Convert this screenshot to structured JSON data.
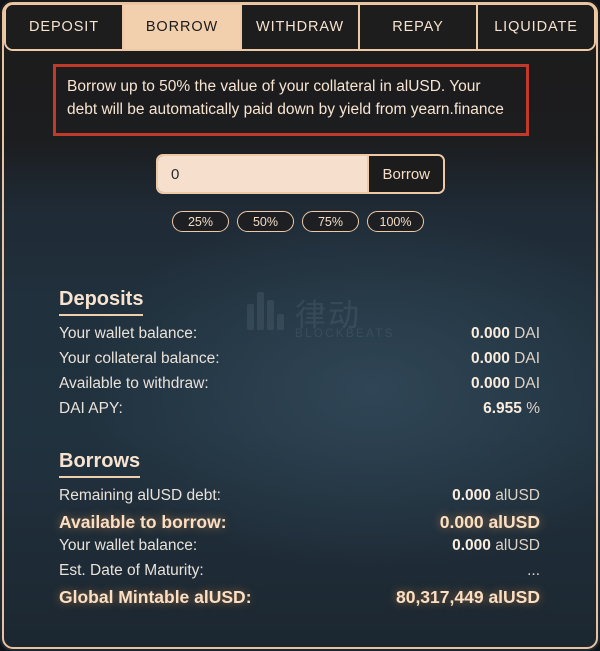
{
  "tabs": [
    {
      "label": "DEPOSIT",
      "active": false
    },
    {
      "label": "BORROW",
      "active": true
    },
    {
      "label": "WITHDRAW",
      "active": false
    },
    {
      "label": "REPAY",
      "active": false
    },
    {
      "label": "LIQUIDATE",
      "active": false
    }
  ],
  "notice": {
    "text": "Borrow up to 50% the value of your collateral in alUSD. Your debt will be automatically paid down by yield from yearn.finance",
    "border_color": "#c0392b"
  },
  "amount": {
    "value": "0",
    "placeholder": "0",
    "action_label": "Borrow"
  },
  "percent_buttons": [
    {
      "label": "25%"
    },
    {
      "label": "50%"
    },
    {
      "label": "75%"
    },
    {
      "label": "100%"
    }
  ],
  "watermark": {
    "cn": "律动",
    "en": "BLOCKBEATS"
  },
  "deposits": {
    "heading": "Deposits",
    "rows": [
      {
        "label": "Your wallet balance:",
        "number": "0.000",
        "unit": "DAI",
        "highlight": false
      },
      {
        "label": "Your collateral balance:",
        "number": "0.000",
        "unit": "DAI",
        "highlight": false
      },
      {
        "label": "Available to withdraw:",
        "number": "0.000",
        "unit": "DAI",
        "highlight": false
      },
      {
        "label": "DAI APY:",
        "number": "6.955",
        "unit": "%",
        "highlight": false
      }
    ]
  },
  "borrows": {
    "heading": "Borrows",
    "rows": [
      {
        "label": "Remaining alUSD debt:",
        "number": "0.000",
        "unit": "alUSD",
        "highlight": false
      },
      {
        "label": "Available to borrow:",
        "number": "0.000",
        "unit": "alUSD",
        "highlight": true
      },
      {
        "label": "Your wallet balance:",
        "number": "0.000",
        "unit": "alUSD",
        "highlight": false
      },
      {
        "label": "Est. Date of Maturity:",
        "number": "",
        "unit": "...",
        "highlight": false
      },
      {
        "label": "Global Mintable alUSD:",
        "number": "80,317,449",
        "unit": "alUSD",
        "highlight": true
      }
    ]
  },
  "theme": {
    "accent": "#eec9a6",
    "active_tab_bg": "#f3d0ad",
    "input_bg": "#f6e0cd",
    "panel_dark": "#1d1d1d",
    "panel_navy": "#21323f",
    "highlight_glow": "#f3a054"
  }
}
